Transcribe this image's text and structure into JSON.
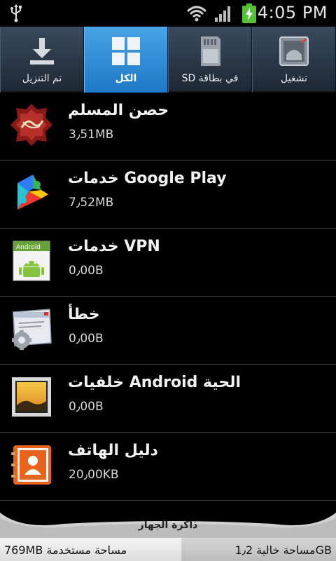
{
  "status_bar": {
    "time": "4:05 PM",
    "icons": [
      "usb-icon",
      "wifi-icon",
      "signal-icon",
      "battery-charging-icon"
    ]
  },
  "tabs": [
    {
      "label": "تم التنزيل",
      "icon": "download-icon",
      "active": false
    },
    {
      "label": "الكل",
      "icon": "grid-icon",
      "active": true
    },
    {
      "label": "في بطاقة SD",
      "icon": "sd-card-icon",
      "active": false
    },
    {
      "label": "تشغيل",
      "icon": "running-app-icon",
      "active": false
    }
  ],
  "apps": [
    {
      "name": "حصن المسلم",
      "size": "3٫51MB",
      "icon": "hisn-muslim-icon"
    },
    {
      "name": "خدمات Google Play",
      "size": "7٫52MB",
      "icon": "google-play-services-icon"
    },
    {
      "name": "خدمات VPN",
      "size": "0٫00B",
      "icon": "vpn-android-icon"
    },
    {
      "name": "خطأ",
      "size": "0٫00B",
      "icon": "error-settings-icon"
    },
    {
      "name": "خلفيات Android الحية",
      "size": "0٫00B",
      "icon": "live-wallpaper-icon"
    },
    {
      "name": "دليل الهاتف",
      "size": "20٫00KB",
      "icon": "contacts-icon"
    }
  ],
  "storage": {
    "caption": "ذاكرة الجهاز",
    "used": "769MB مساحة مستخدمة",
    "free": "مساحة خالية 1٫2GB"
  },
  "colors": {
    "active_tab": "#2a88d6",
    "background": "#000000",
    "accent_green": "#52c234"
  }
}
